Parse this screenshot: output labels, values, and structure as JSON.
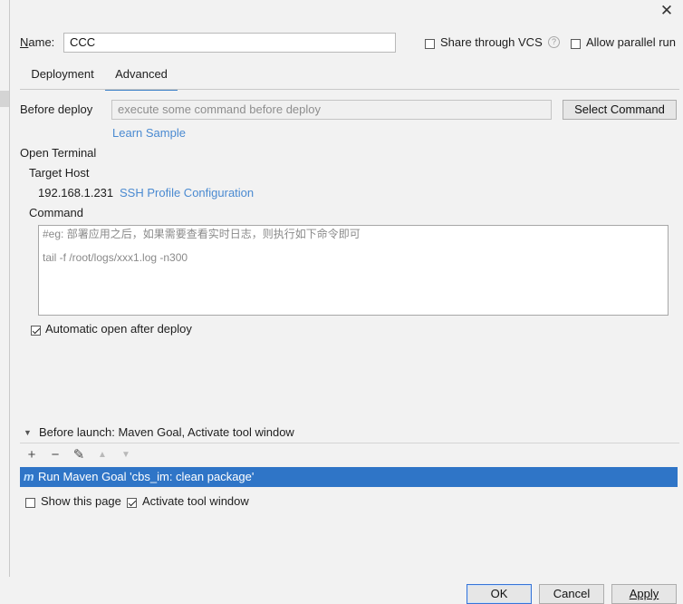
{
  "window": {
    "close_glyph": "✕"
  },
  "name": {
    "label": "Name:",
    "value": "CCC"
  },
  "share_vcs": {
    "label": "Share through VCS",
    "checked": false,
    "help_glyph": "?"
  },
  "allow_parallel": {
    "label": "Allow parallel run",
    "checked": false
  },
  "tabs": [
    {
      "label": "Deployment",
      "active": false
    },
    {
      "label": "Advanced",
      "active": true
    }
  ],
  "before_deploy": {
    "label": "Before deploy",
    "placeholder": "execute some command before deploy",
    "select_button": "Select Command",
    "learn_sample": "Learn Sample"
  },
  "open_terminal": {
    "label": "Open Terminal",
    "target_host_label": "Target Host",
    "host": "192.168.1.231",
    "ssh_link": "SSH Profile Configuration",
    "command_label": "Command",
    "command_lines": [
      "#eg: 部署应用之后，如果需要查看实时日志，则执行如下命令即可",
      "tail -f /root/logs/xxx1.log -n300"
    ],
    "auto_open_label": "Automatic open after deploy",
    "auto_open_checked": true
  },
  "before_launch": {
    "label": "Before launch: Maven Goal, Activate tool window",
    "toolbar": {
      "add": "+",
      "remove": "−",
      "edit": "✎",
      "up": "▲",
      "down": "▼"
    },
    "items": [
      {
        "icon": "maven-icon",
        "text": "Run Maven Goal 'cbs_im: clean package'"
      }
    ],
    "show_page_label": "Show this page",
    "show_page_checked": false,
    "activate_label": "Activate tool window",
    "activate_checked": true
  },
  "buttons": {
    "ok": "OK",
    "cancel": "Cancel",
    "apply": "Apply"
  },
  "colors": {
    "accent": "#2f75c7",
    "link": "#4a8ad1",
    "tab_underline": "#4083c9"
  }
}
